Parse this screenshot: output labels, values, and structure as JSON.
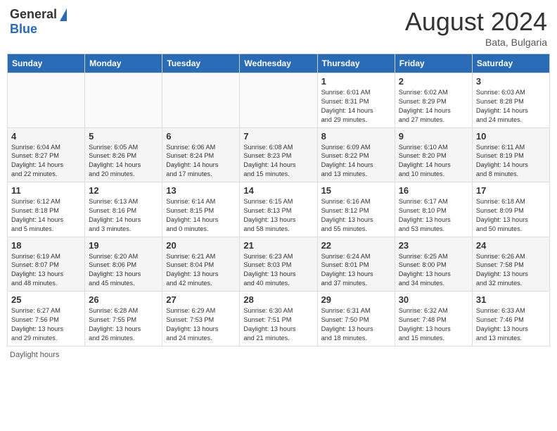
{
  "header": {
    "logo_general": "General",
    "logo_blue": "Blue",
    "month_year": "August 2024",
    "location": "Bata, Bulgaria"
  },
  "days_of_week": [
    "Sunday",
    "Monday",
    "Tuesday",
    "Wednesday",
    "Thursday",
    "Friday",
    "Saturday"
  ],
  "footer": {
    "daylight_label": "Daylight hours"
  },
  "weeks": [
    {
      "days": [
        {
          "number": "",
          "info": ""
        },
        {
          "number": "",
          "info": ""
        },
        {
          "number": "",
          "info": ""
        },
        {
          "number": "",
          "info": ""
        },
        {
          "number": "1",
          "info": "Sunrise: 6:01 AM\nSunset: 8:31 PM\nDaylight: 14 hours\nand 29 minutes."
        },
        {
          "number": "2",
          "info": "Sunrise: 6:02 AM\nSunset: 8:29 PM\nDaylight: 14 hours\nand 27 minutes."
        },
        {
          "number": "3",
          "info": "Sunrise: 6:03 AM\nSunset: 8:28 PM\nDaylight: 14 hours\nand 24 minutes."
        }
      ]
    },
    {
      "days": [
        {
          "number": "4",
          "info": "Sunrise: 6:04 AM\nSunset: 8:27 PM\nDaylight: 14 hours\nand 22 minutes."
        },
        {
          "number": "5",
          "info": "Sunrise: 6:05 AM\nSunset: 8:26 PM\nDaylight: 14 hours\nand 20 minutes."
        },
        {
          "number": "6",
          "info": "Sunrise: 6:06 AM\nSunset: 8:24 PM\nDaylight: 14 hours\nand 17 minutes."
        },
        {
          "number": "7",
          "info": "Sunrise: 6:08 AM\nSunset: 8:23 PM\nDaylight: 14 hours\nand 15 minutes."
        },
        {
          "number": "8",
          "info": "Sunrise: 6:09 AM\nSunset: 8:22 PM\nDaylight: 14 hours\nand 13 minutes."
        },
        {
          "number": "9",
          "info": "Sunrise: 6:10 AM\nSunset: 8:20 PM\nDaylight: 14 hours\nand 10 minutes."
        },
        {
          "number": "10",
          "info": "Sunrise: 6:11 AM\nSunset: 8:19 PM\nDaylight: 14 hours\nand 8 minutes."
        }
      ]
    },
    {
      "days": [
        {
          "number": "11",
          "info": "Sunrise: 6:12 AM\nSunset: 8:18 PM\nDaylight: 14 hours\nand 5 minutes."
        },
        {
          "number": "12",
          "info": "Sunrise: 6:13 AM\nSunset: 8:16 PM\nDaylight: 14 hours\nand 3 minutes."
        },
        {
          "number": "13",
          "info": "Sunrise: 6:14 AM\nSunset: 8:15 PM\nDaylight: 14 hours\nand 0 minutes."
        },
        {
          "number": "14",
          "info": "Sunrise: 6:15 AM\nSunset: 8:13 PM\nDaylight: 13 hours\nand 58 minutes."
        },
        {
          "number": "15",
          "info": "Sunrise: 6:16 AM\nSunset: 8:12 PM\nDaylight: 13 hours\nand 55 minutes."
        },
        {
          "number": "16",
          "info": "Sunrise: 6:17 AM\nSunset: 8:10 PM\nDaylight: 13 hours\nand 53 minutes."
        },
        {
          "number": "17",
          "info": "Sunrise: 6:18 AM\nSunset: 8:09 PM\nDaylight: 13 hours\nand 50 minutes."
        }
      ]
    },
    {
      "days": [
        {
          "number": "18",
          "info": "Sunrise: 6:19 AM\nSunset: 8:07 PM\nDaylight: 13 hours\nand 48 minutes."
        },
        {
          "number": "19",
          "info": "Sunrise: 6:20 AM\nSunset: 8:06 PM\nDaylight: 13 hours\nand 45 minutes."
        },
        {
          "number": "20",
          "info": "Sunrise: 6:21 AM\nSunset: 8:04 PM\nDaylight: 13 hours\nand 42 minutes."
        },
        {
          "number": "21",
          "info": "Sunrise: 6:23 AM\nSunset: 8:03 PM\nDaylight: 13 hours\nand 40 minutes."
        },
        {
          "number": "22",
          "info": "Sunrise: 6:24 AM\nSunset: 8:01 PM\nDaylight: 13 hours\nand 37 minutes."
        },
        {
          "number": "23",
          "info": "Sunrise: 6:25 AM\nSunset: 8:00 PM\nDaylight: 13 hours\nand 34 minutes."
        },
        {
          "number": "24",
          "info": "Sunrise: 6:26 AM\nSunset: 7:58 PM\nDaylight: 13 hours\nand 32 minutes."
        }
      ]
    },
    {
      "days": [
        {
          "number": "25",
          "info": "Sunrise: 6:27 AM\nSunset: 7:56 PM\nDaylight: 13 hours\nand 29 minutes."
        },
        {
          "number": "26",
          "info": "Sunrise: 6:28 AM\nSunset: 7:55 PM\nDaylight: 13 hours\nand 26 minutes."
        },
        {
          "number": "27",
          "info": "Sunrise: 6:29 AM\nSunset: 7:53 PM\nDaylight: 13 hours\nand 24 minutes."
        },
        {
          "number": "28",
          "info": "Sunrise: 6:30 AM\nSunset: 7:51 PM\nDaylight: 13 hours\nand 21 minutes."
        },
        {
          "number": "29",
          "info": "Sunrise: 6:31 AM\nSunset: 7:50 PM\nDaylight: 13 hours\nand 18 minutes."
        },
        {
          "number": "30",
          "info": "Sunrise: 6:32 AM\nSunset: 7:48 PM\nDaylight: 13 hours\nand 15 minutes."
        },
        {
          "number": "31",
          "info": "Sunrise: 6:33 AM\nSunset: 7:46 PM\nDaylight: 13 hours\nand 13 minutes."
        }
      ]
    }
  ]
}
